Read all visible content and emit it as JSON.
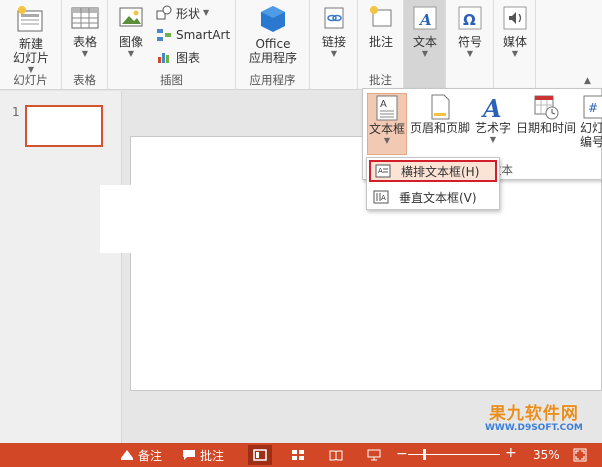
{
  "ribbon": {
    "groups": {
      "slides": {
        "label": "幻灯片",
        "new_slide": "新建\n幻灯片"
      },
      "tables": {
        "label": "表格",
        "table": "表格"
      },
      "images": {
        "label": "插图",
        "picture": "图像",
        "shapes": "形状",
        "smartart": "SmartArt",
        "chart": "图表"
      },
      "apps": {
        "label": "应用程序",
        "office_apps": "Office\n应用程序"
      },
      "links": {
        "label": "",
        "link": "链接"
      },
      "comments": {
        "label": "批注",
        "comment": "批注"
      },
      "text": {
        "label": "文本",
        "text": "文本"
      },
      "symbols": {
        "label": "",
        "symbol": "符号"
      },
      "media": {
        "label": "",
        "media": "媒体"
      }
    }
  },
  "text_gallery": {
    "items": [
      "文本框",
      "页眉和页脚",
      "艺术字",
      "日期和时间",
      "幻灯\n编号"
    ],
    "group_label": "文本"
  },
  "textbox_menu": {
    "horizontal": "横排文本框(H)",
    "vertical": "垂直文本框(V)"
  },
  "slides_panel": {
    "thumb_number": "1"
  },
  "status_bar": {
    "notes": "备注",
    "comments": "批注",
    "zoom": "35%"
  },
  "watermark": {
    "main": "果九软件网",
    "sub": "WWW.D9SOFT.COM"
  },
  "colors": {
    "accent": "#d24726",
    "highlight_border": "#d21f2b"
  }
}
